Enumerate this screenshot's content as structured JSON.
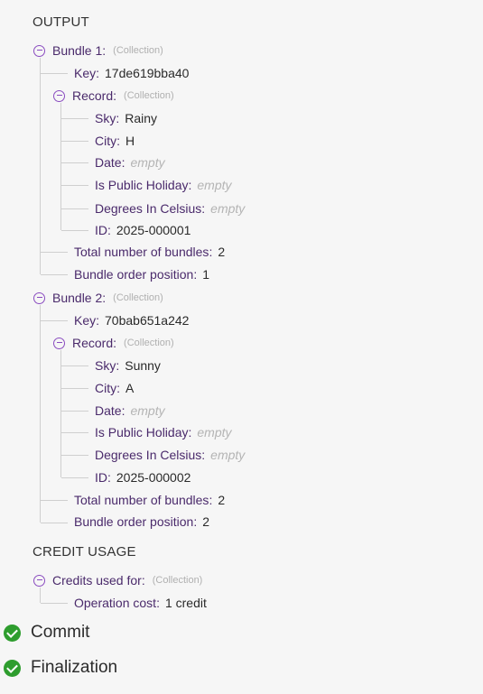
{
  "output": {
    "title": "OUTPUT",
    "bundles": [
      {
        "label": "Bundle 1",
        "tag": "(Collection)",
        "key": {
          "label": "Key",
          "value": "17de619bba40"
        },
        "record": {
          "label": "Record",
          "tag": "(Collection)",
          "fields": [
            {
              "label": "Sky",
              "value": "Rainy",
              "empty": false
            },
            {
              "label": "City",
              "value": "H",
              "empty": false
            },
            {
              "label": "Date",
              "value": "empty",
              "empty": true
            },
            {
              "label": "Is Public Holiday",
              "value": "empty",
              "empty": true
            },
            {
              "label": "Degrees In Celsius",
              "value": "empty",
              "empty": true
            },
            {
              "label": "ID",
              "value": "2025-000001",
              "empty": false
            }
          ]
        },
        "total": {
          "label": "Total number of bundles",
          "value": "2"
        },
        "position": {
          "label": "Bundle order position",
          "value": "1"
        }
      },
      {
        "label": "Bundle 2",
        "tag": "(Collection)",
        "key": {
          "label": "Key",
          "value": "70bab651a242"
        },
        "record": {
          "label": "Record",
          "tag": "(Collection)",
          "fields": [
            {
              "label": "Sky",
              "value": "Sunny",
              "empty": false
            },
            {
              "label": "City",
              "value": "A",
              "empty": false
            },
            {
              "label": "Date",
              "value": "empty",
              "empty": true
            },
            {
              "label": "Is Public Holiday",
              "value": "empty",
              "empty": true
            },
            {
              "label": "Degrees In Celsius",
              "value": "empty",
              "empty": true
            },
            {
              "label": "ID",
              "value": "2025-000002",
              "empty": false
            }
          ]
        },
        "total": {
          "label": "Total number of bundles",
          "value": "2"
        },
        "position": {
          "label": "Bundle order position",
          "value": "2"
        }
      }
    ]
  },
  "credit_usage": {
    "title": "CREDIT USAGE",
    "group": {
      "label": "Credits used for",
      "tag": "(Collection)"
    },
    "items": [
      {
        "label": "Operation cost",
        "value": "1 credit"
      }
    ]
  },
  "steps": [
    {
      "label": "Commit",
      "icon": "check-circle-icon",
      "color": "#2e9d2e"
    },
    {
      "label": "Finalization",
      "icon": "check-circle-icon",
      "color": "#2e9d2e"
    }
  ]
}
